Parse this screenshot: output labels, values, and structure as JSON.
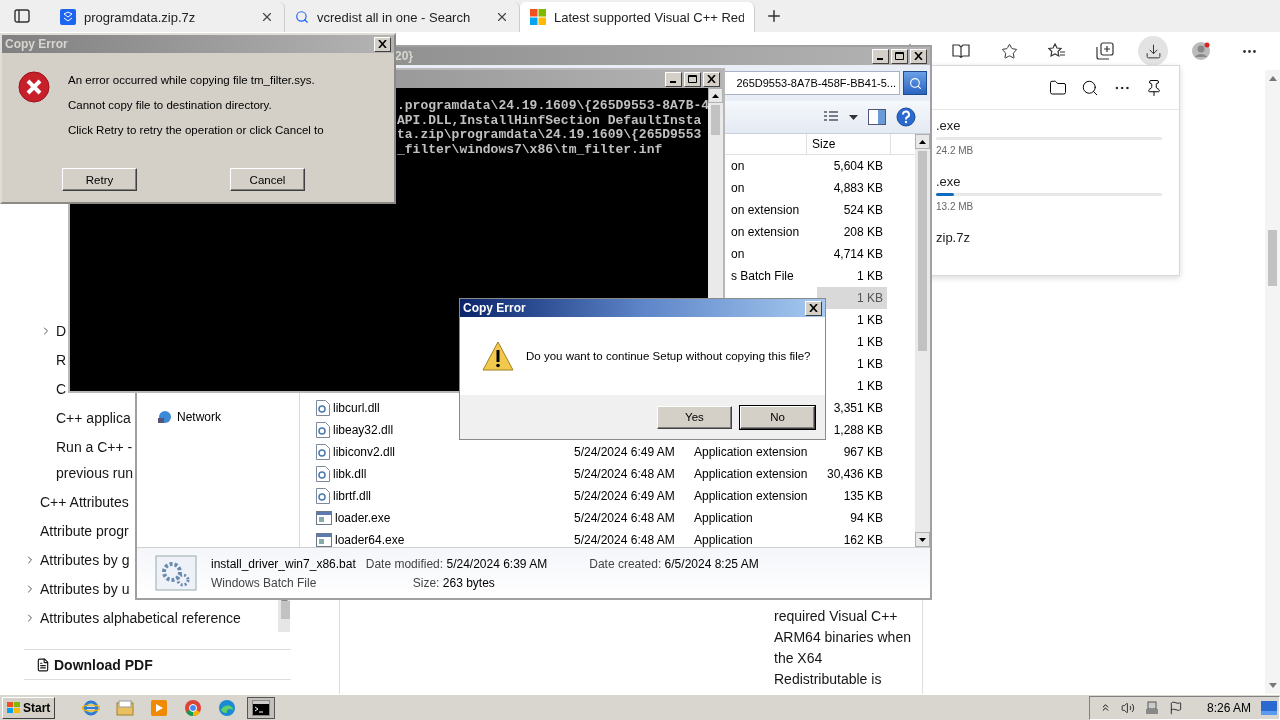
{
  "browser": {
    "tabs": [
      {
        "kind": "file",
        "title": "programdata.zip.7z",
        "selected": false,
        "closable": true
      },
      {
        "kind": "search",
        "title": "vcredist all in one - Search",
        "selected": false,
        "closable": true
      },
      {
        "kind": "page",
        "title": "Latest supported Visual C++ Red",
        "selected": true,
        "closable": false
      }
    ],
    "toolbar": {
      "downloads_active": true
    },
    "nav": {
      "nested_items": [
        {
          "lines": [
            "D"
          ],
          "expandable": true
        },
        {
          "lines": [
            "R"
          ],
          "expandable": false
        },
        {
          "lines": [
            "C"
          ],
          "expandable": false
        },
        {
          "lines": [
            "C++ applica"
          ],
          "expandable": false
        },
        {
          "lines": [
            "Run a C++ -",
            "previous run"
          ],
          "expandable": false
        }
      ],
      "items": [
        {
          "lines": [
            "C++ Attributes"
          ],
          "expandable": false
        },
        {
          "lines": [
            "Attribute progr"
          ],
          "expandable": false
        },
        {
          "lines": [
            "Attributes by g"
          ],
          "expandable": true
        },
        {
          "lines": [
            "Attributes by u"
          ],
          "expandable": true
        },
        {
          "lines": [
            "Attributes alphabetical reference"
          ],
          "expandable": true
        }
      ],
      "download_link": "Download PDF"
    },
    "article_lines": [
      "required Visual C++",
      "ARM64 binaries when",
      "the X64",
      "Redistributable is"
    ],
    "downloads": {
      "items": [
        {
          "name": ".exe",
          "size": "24.2 MB",
          "level": 0
        },
        {
          "name": ".exe",
          "size": "13.2 MB",
          "level": 0.08
        },
        {
          "name": "zip.7z"
        }
      ]
    }
  },
  "explorer": {
    "title": "20}",
    "address": "265D9553-8A7B-458F-BB41-5...",
    "columns": [
      {
        "label": "Size"
      }
    ],
    "nav_items": [
      "Network"
    ],
    "rows": [
      {
        "type": "on",
        "size": "5,604 KB",
        "selected": false
      },
      {
        "type": "on",
        "size": "4,883 KB",
        "selected": false
      },
      {
        "type": "on extension",
        "size": "524 KB",
        "selected": false
      },
      {
        "type": "on extension",
        "size": "208 KB",
        "selected": false
      },
      {
        "type": "on",
        "size": "4,714 KB",
        "selected": false
      },
      {
        "type": "s Batch File",
        "size": "1 KB",
        "selected": false
      },
      {
        "size": "1 KB",
        "selected": true
      },
      {
        "size": "1 KB",
        "selected": false
      },
      {
        "size": "1 KB",
        "selected": false
      },
      {
        "size": "1 KB",
        "selected": false
      },
      {
        "size": "1 KB",
        "selected": false
      },
      {
        "kind": "dll",
        "name": "libcurl.dll",
        "size": "3,351 KB",
        "selected": false
      },
      {
        "kind": "dll",
        "name": "libeay32.dll",
        "size": "1,288 KB",
        "selected": false
      },
      {
        "kind": "dll",
        "name": "libiconv2.dll",
        "date": "5/24/2024 6:49 AM",
        "type": "Application extension",
        "size": "967 KB",
        "selected": false
      },
      {
        "kind": "dll",
        "name": "libk.dll",
        "date": "5/24/2024 6:48 AM",
        "type": "Application extension",
        "size": "30,436 KB",
        "selected": false
      },
      {
        "kind": "dll",
        "name": "librtf.dll",
        "date": "5/24/2024 6:49 AM",
        "type": "Application extension",
        "size": "135 KB",
        "selected": false
      },
      {
        "kind": "exe",
        "name": "loader.exe",
        "date": "5/24/2024 6:48 AM",
        "type": "Application",
        "size": "94 KB",
        "selected": false
      },
      {
        "kind": "exe",
        "name": "loader64.exe",
        "date": "5/24/2024 6:48 AM",
        "type": "Application",
        "size": "162 KB",
        "selected": false
      }
    ],
    "details": {
      "name": "install_driver_win7_x86.bat",
      "type": "Windows Batch File",
      "modified_label": "Date modified:",
      "modified": "5/24/2024 6:39 AM",
      "size_label": "Size:",
      "size": "263 bytes",
      "created_label": "Date created:",
      "created": "6/5/2024 8:25 AM"
    }
  },
  "console": {
    "lines": [
      ".programdata\\24.19.1609\\{265D9553-8A7B-4",
      "API.DLL,InstallHinfSection DefaultInsta",
      "ta.zip\\programdata\\24.19.1609\\{265D9553",
      "_filter\\windows7\\x86\\tm_filter.inf"
    ]
  },
  "error_dialog": {
    "title": "Copy Error",
    "lines": [
      "An error occurred while copying file tm_filter.sys.",
      "Cannot copy file to destination directory.",
      "Click Retry to retry the operation or click Cancel to"
    ],
    "buttons": [
      "Retry",
      "Cancel"
    ]
  },
  "confirm_dialog": {
    "title": "Copy Error",
    "message": "Do you want to continue Setup without copying this file?",
    "buttons": [
      {
        "label": "Yes",
        "focused": false
      },
      {
        "label": "No",
        "focused": true
      }
    ]
  },
  "taskbar": {
    "start": "Start",
    "apps": [
      {
        "kind": "ie",
        "active": false
      },
      {
        "kind": "folder",
        "active": false
      },
      {
        "kind": "media",
        "active": false
      },
      {
        "kind": "chrome",
        "active": false
      },
      {
        "kind": "edge",
        "active": false
      },
      {
        "kind": "cmd",
        "active": true
      }
    ],
    "clock": "8:26 AM"
  }
}
